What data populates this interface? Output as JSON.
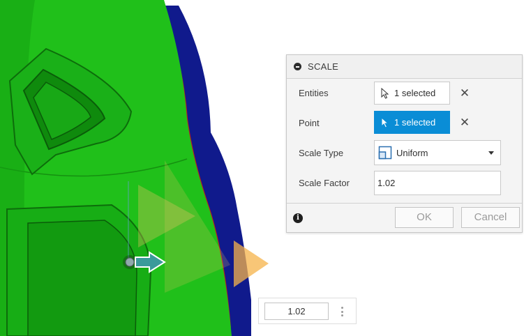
{
  "scale_dialog": {
    "title": "SCALE",
    "entities": {
      "label": "Entities",
      "value": "1 selected",
      "clear_glyph": "✕"
    },
    "point": {
      "label": "Point",
      "value": "1 selected",
      "clear_glyph": "✕"
    },
    "scale_type": {
      "label": "Scale Type",
      "value": "Uniform"
    },
    "scale_factor": {
      "label": "Scale Factor",
      "value": "1.02"
    },
    "ok_label": "OK",
    "cancel_label": "Cancel",
    "info_glyph": "i"
  },
  "viewport_input": {
    "value": "1.02"
  },
  "colors": {
    "model_green": "#20c01a",
    "model_blue": "#101a8c",
    "accent_blue": "#0a8dd6",
    "manipulator_teal": "#3a9a9a",
    "manipulator_orange": "#f5b34a"
  },
  "icons": [
    "collapse-icon",
    "cursor-icon",
    "close-icon",
    "scale-type-icon",
    "chevron-down-icon",
    "info-icon",
    "kebab-menu-icon",
    "scale-arrow-icon"
  ]
}
